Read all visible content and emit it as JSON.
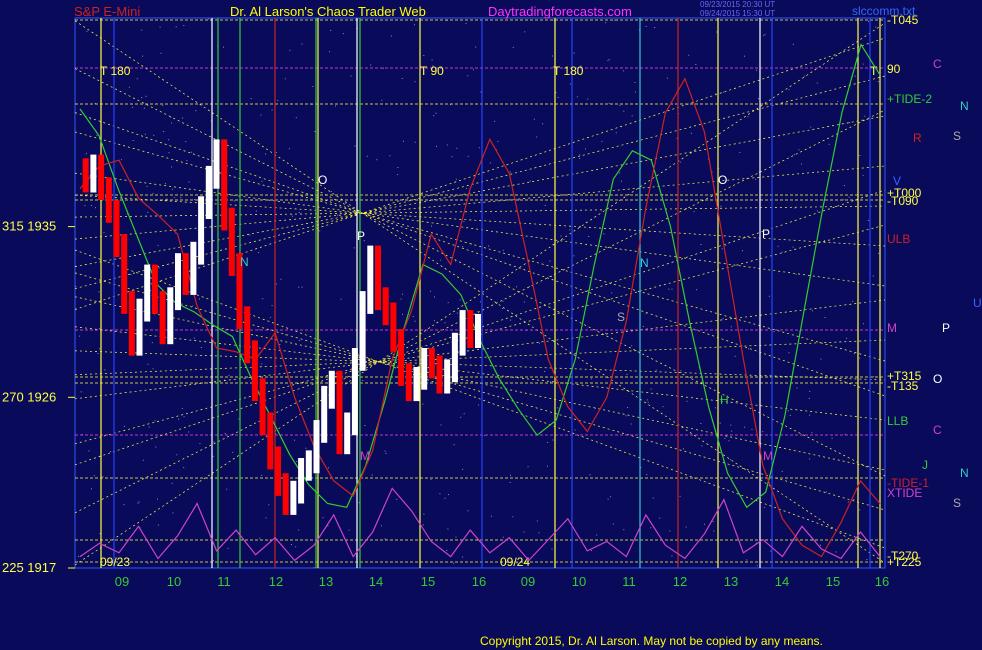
{
  "header": {
    "instrument": "S&P E-Mini",
    "site": "Dr. Al Larson's Chaos Trader Web",
    "url": "Daytradingforecasts.com",
    "timestamp1": "09/23/2015 20:30 UT",
    "timestamp2": "09/24/2015 15:30 UT",
    "ticker": "slccomm.txt"
  },
  "copyright": "Copyright 2015, Dr. Al Larson. May not be copied by any means.",
  "colors": {
    "background": "#0a0a5a",
    "price_up": "#ffffff",
    "price_down": "#ff0000",
    "green": "#33cc33",
    "red": "#cc2222",
    "magenta": "#cc44cc",
    "yellow": "#ffff44",
    "cyan": "#33cccc"
  },
  "chart_data": {
    "type": "line",
    "xlabel": "",
    "ylabel": "",
    "x_ticks": [
      "09",
      "10",
      "11",
      "12",
      "13",
      "14",
      "15",
      "16",
      "09",
      "10",
      "11",
      "12",
      "13",
      "14",
      "15",
      "16"
    ],
    "date_labels": [
      "09/23",
      "09/24"
    ],
    "y_ticks": [
      {
        "label": "315  1935",
        "value": 1935
      },
      {
        "label": "270  1926",
        "value": 1926
      },
      {
        "label": "225  1917",
        "value": 1917
      }
    ],
    "ylim": [
      1917,
      1946
    ],
    "cycle_labels_top": [
      "T  180",
      "T  90",
      "T  180",
      "T"
    ],
    "right_labels": [
      {
        "text": "-T045",
        "color": "#ffff44"
      },
      {
        "text": "90",
        "color": "#ffff44"
      },
      {
        "text": "+TIDE-2",
        "color": "#33cc33"
      },
      {
        "text": "+T000",
        "color": "#ffff44"
      },
      {
        "text": "-T090",
        "color": "#ffff44"
      },
      {
        "text": "ULB",
        "color": "#cc2222"
      },
      {
        "text": "M",
        "color": "#cc44cc"
      },
      {
        "text": "+T315",
        "color": "#ffff44"
      },
      {
        "text": "-T135",
        "color": "#ffff44"
      },
      {
        "text": "LLB",
        "color": "#33cc33"
      },
      {
        "text": "-TIDE-1",
        "color": "#cc2222"
      },
      {
        "text": "XTIDE",
        "color": "#cc44cc"
      },
      {
        "text": "-T270",
        "color": "#ffff44"
      },
      {
        "text": "+T225",
        "color": "#ffff44"
      }
    ],
    "planet_labels": [
      {
        "text": "C",
        "color": "#cc44cc"
      },
      {
        "text": "N",
        "color": "#33cccc"
      },
      {
        "text": "R",
        "color": "#cc2222"
      },
      {
        "text": "S",
        "color": "#aaaaaa"
      },
      {
        "text": "V",
        "color": "#3366ff"
      },
      {
        "text": "U",
        "color": "#3366ff"
      },
      {
        "text": "P",
        "color": "#ffffff"
      },
      {
        "text": "O",
        "color": "#ffffff"
      },
      {
        "text": "C",
        "color": "#cc44cc"
      },
      {
        "text": "J",
        "color": "#33cc33"
      },
      {
        "text": "N",
        "color": "#33cccc"
      },
      {
        "text": "S",
        "color": "#aaaaaa"
      }
    ],
    "in_chart_labels": [
      {
        "text": "O",
        "color": "#ffffff"
      },
      {
        "text": "P",
        "color": "#ffffff"
      },
      {
        "text": "N",
        "color": "#33cccc"
      },
      {
        "text": "M",
        "color": "#cc44cc"
      },
      {
        "text": "N",
        "color": "#33cccc"
      },
      {
        "text": "S",
        "color": "#aaaaaa"
      },
      {
        "text": "O",
        "color": "#ffffff"
      },
      {
        "text": "P",
        "color": "#ffffff"
      },
      {
        "text": "M",
        "color": "#cc44cc"
      },
      {
        "text": "H",
        "color": "#33cc33"
      }
    ],
    "price": [
      1938.0,
      1937.4,
      1938.2,
      1937.0,
      1935.8,
      1934.0,
      1931.0,
      1928.8,
      1930.6,
      1932.4,
      1931.0,
      1929.4,
      1931.2,
      1933.0,
      1932.0,
      1933.6,
      1936.0,
      1937.6,
      1939.0,
      1935.4,
      1933.0,
      1930.2,
      1928.4,
      1926.4,
      1924.6,
      1922.8,
      1921.4,
      1920.4,
      1921.0,
      1922.2,
      1922.6,
      1924.2,
      1926.0,
      1926.8,
      1923.6,
      1924.6,
      1928.0,
      1931.0,
      1933.4,
      1931.2,
      1930.4,
      1929.0,
      1927.2,
      1926.4,
      1927.0,
      1928.0,
      1927.6,
      1926.8,
      1927.4,
      1928.8,
      1930.0,
      1929.2,
      1929.8
    ],
    "series": [
      {
        "name": "",
        "color": "#33cc33",
        "values": [
          1941.2,
          1939.8,
          1937.0,
          1934.5,
          1932.0,
          1931.0,
          1930.5,
          1929.8,
          1929.2,
          1927.0,
          1925.0,
          1923.0,
          1921.4,
          1920.4,
          1920.2,
          1922.4,
          1925.8,
          1929.6,
          1933.0,
          1932.5,
          1931.4,
          1929.0,
          1927.0,
          1925.4,
          1924.0,
          1924.8,
          1928.0,
          1933.0,
          1937.5,
          1939.0,
          1938.5,
          1935.0,
          1930.0,
          1925.5,
          1922.0,
          1920.2,
          1921.0,
          1925.0,
          1930.5,
          1936.0,
          1941.0,
          1944.6,
          1943.0
        ]
      },
      {
        "name": "",
        "color": "#cc2222",
        "values": [
          1937.0,
          1938.2,
          1938.5,
          1936.5,
          1935.6,
          1934.6,
          1930.8,
          1928.6,
          1928.4,
          1928.0,
          1929.4,
          1926.0,
          1923.4,
          1921.6,
          1920.8,
          1923.2,
          1928.0,
          1930.6,
          1934.6,
          1933.0,
          1937.0,
          1939.6,
          1937.8,
          1933.0,
          1928.0,
          1925.5,
          1924.2,
          1926.0,
          1930.0,
          1936.0,
          1941.0,
          1942.8,
          1940.0,
          1934.0,
          1928.0,
          1922.4,
          1919.6,
          1918.2,
          1917.6,
          1919.4,
          1921.6,
          1920.4
        ]
      },
      {
        "name": "",
        "color": "#cc44cc",
        "values": [
          1917.6,
          1918.3,
          1917.8,
          1919.2,
          1917.5,
          1918.7,
          1920.4,
          1917.9,
          1919.0,
          1917.7,
          1918.6,
          1917.4,
          1918.2,
          1919.8,
          1917.6,
          1918.9,
          1921.2,
          1920.0,
          1918.4,
          1917.6,
          1919.0,
          1917.8,
          1918.6,
          1917.4,
          1918.5,
          1919.6,
          1917.9,
          1918.4,
          1917.6,
          1919.8,
          1918.2,
          1917.5,
          1918.8,
          1920.6,
          1917.8,
          1918.5,
          1917.6,
          1919.2,
          1918.0,
          1917.5,
          1918.9,
          1917.6
        ]
      }
    ]
  }
}
